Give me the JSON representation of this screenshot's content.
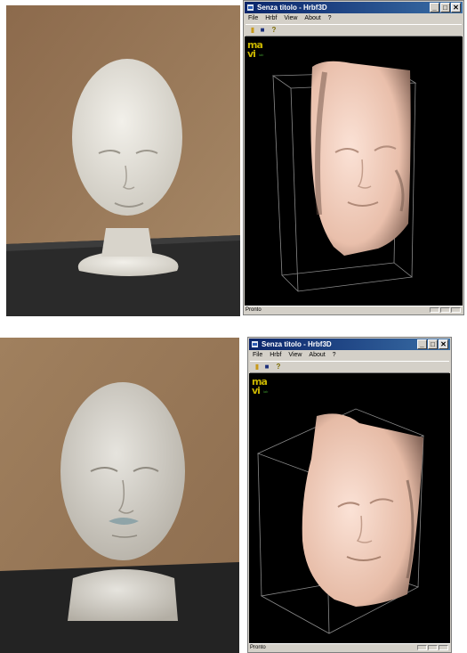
{
  "panels": [
    {
      "window": {
        "title": "Senza titolo - Hrbf3D",
        "menu": [
          "File",
          "Hrbf",
          "View",
          "About",
          "?"
        ],
        "status": "Pronto",
        "logo": [
          "ma",
          "vi",
          "lab"
        ]
      }
    },
    {
      "window": {
        "title": "Senza titolo - Hrbf3D",
        "menu": [
          "File",
          "Hrbf",
          "View",
          "About",
          "?"
        ],
        "status": "Pronto",
        "logo": [
          "ma",
          "vi",
          "lab"
        ]
      }
    }
  ],
  "window_buttons": {
    "minimize": "_",
    "maximize": "□",
    "close": "✕"
  },
  "toolbar_icons": [
    "open-folder-icon",
    "save-disk-icon",
    "help-icon"
  ],
  "colors": {
    "title_start": "#0a246a",
    "title_end": "#3a6ea5",
    "face_skin": "#f1cbb9",
    "viewport_bg": "#000000"
  }
}
